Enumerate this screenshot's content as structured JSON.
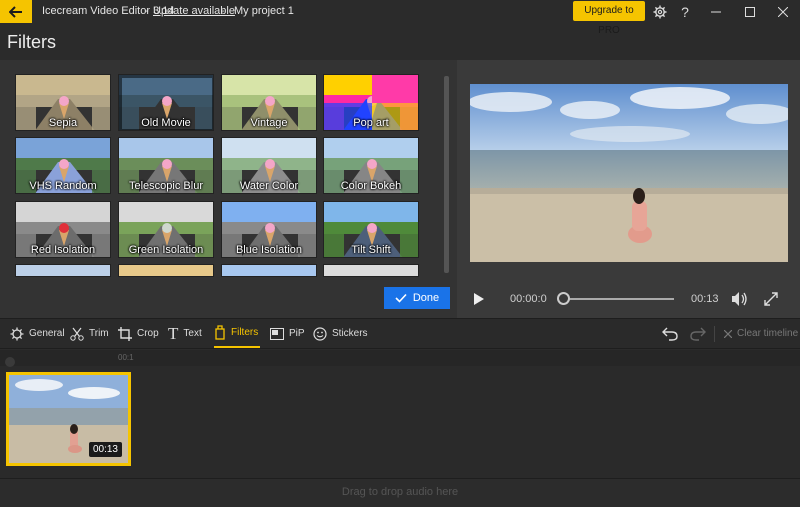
{
  "titlebar": {
    "app_name": "Icecream Video Editor 3.14",
    "separator": "-",
    "update_link": "Update available",
    "separator2": "-",
    "project_name": "My project 1",
    "upgrade_label": "Upgrade to PRO",
    "accent": "#f5c400"
  },
  "page": {
    "title": "Filters"
  },
  "filters": [
    {
      "label": "Sepia"
    },
    {
      "label": "Old Movie"
    },
    {
      "label": "Vintage"
    },
    {
      "label": "Pop art"
    },
    {
      "label": "VHS Random"
    },
    {
      "label": "Telescopic Blur"
    },
    {
      "label": "Water Color"
    },
    {
      "label": "Color Bokeh"
    },
    {
      "label": "Red Isolation"
    },
    {
      "label": "Green Isolation"
    },
    {
      "label": "Blue Isolation"
    },
    {
      "label": "Tilt Shift"
    }
  ],
  "done_label": "Done",
  "player": {
    "current_time": "00:00:0",
    "duration": "00:13",
    "progress": 0
  },
  "toolbar": {
    "general": "General",
    "trim": "Trim",
    "crop": "Crop",
    "text": "Text",
    "filters": "Filters",
    "pip": "PiP",
    "stickers": "Stickers",
    "clear_timeline": "Clear timeline"
  },
  "timeline": {
    "ruler_mark": "00:1",
    "clip_duration": "00:13",
    "audio_hint": "Drag to drop audio here"
  }
}
